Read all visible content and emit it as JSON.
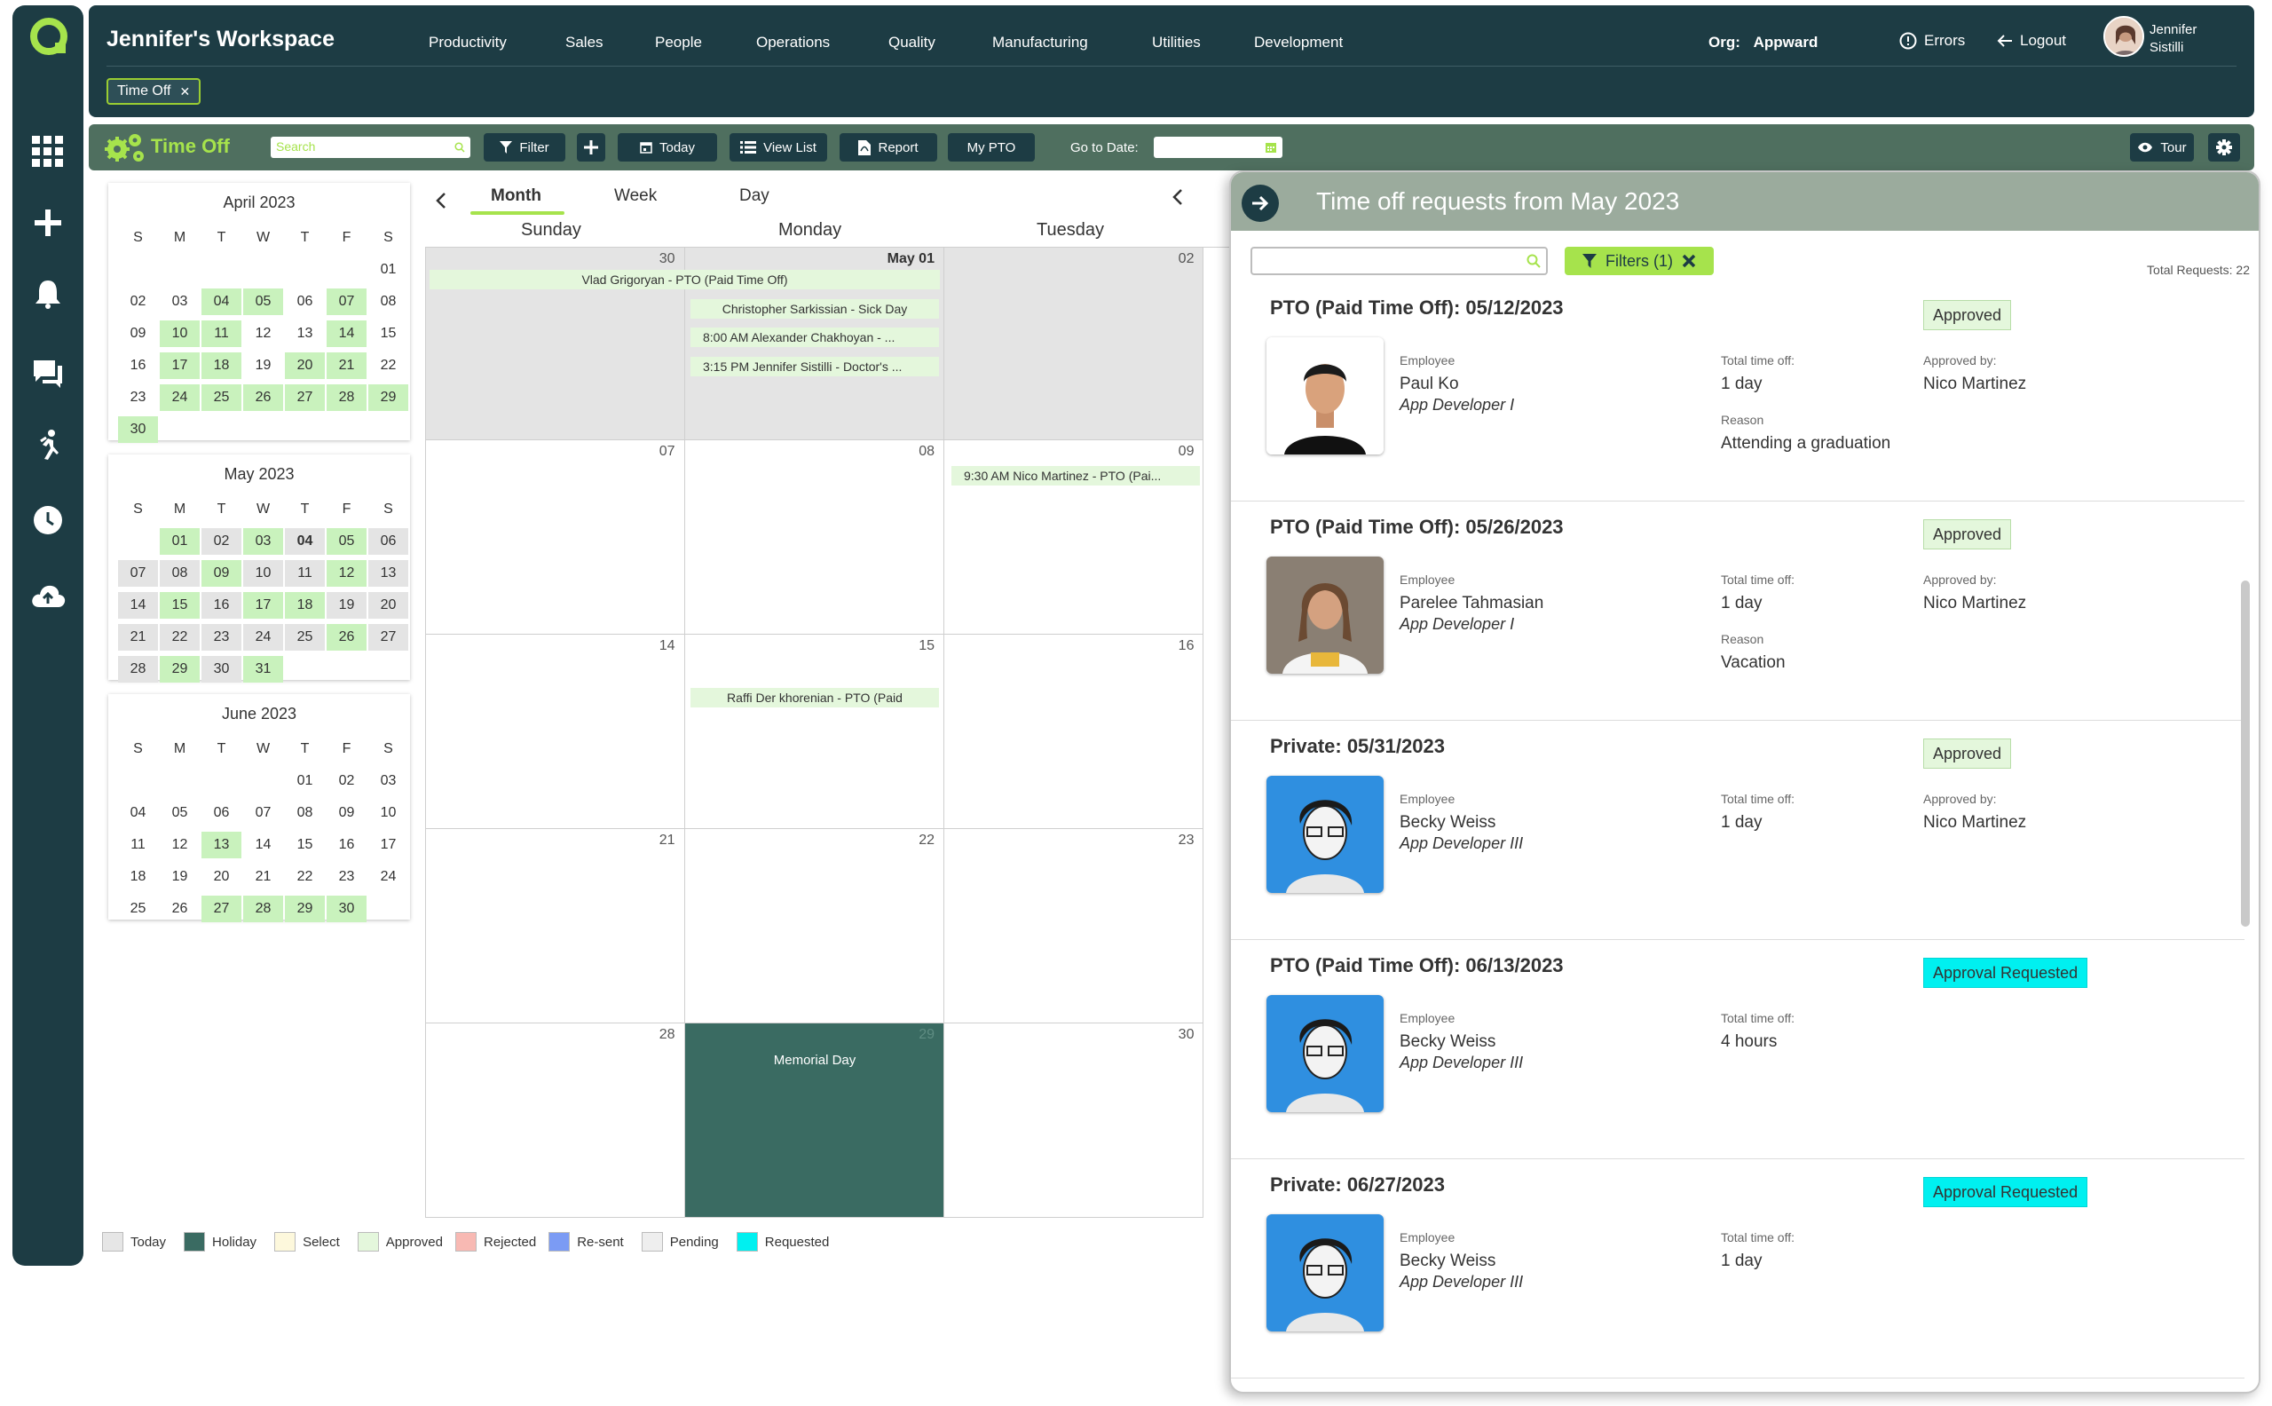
{
  "header": {
    "workspace_title": "Jennifer's Workspace",
    "nav": [
      "Productivity",
      "Sales",
      "People",
      "Operations",
      "Quality",
      "Manufacturing",
      "Utilities",
      "Development"
    ],
    "org_label": "Org:",
    "org_value": "Appward",
    "errors": "Errors",
    "logout": "Logout",
    "user_first": "Jennifer",
    "user_last": "Sistilli",
    "chip": "Time Off"
  },
  "toolbar": {
    "title": "Time Off",
    "search_placeholder": "Search",
    "filter": "Filter",
    "today": "Today",
    "view_list": "View List",
    "report": "Report",
    "my_pto": "My PTO",
    "goto_date": "Go to Date:",
    "tour": "Tour"
  },
  "minicals": [
    {
      "title": "April 2023",
      "dow": [
        "S",
        "M",
        "T",
        "W",
        "T",
        "F",
        "S"
      ],
      "cells": [
        {
          "d": "",
          "c": ""
        },
        {
          "d": "",
          "c": ""
        },
        {
          "d": "",
          "c": ""
        },
        {
          "d": "",
          "c": ""
        },
        {
          "d": "",
          "c": ""
        },
        {
          "d": "",
          "c": ""
        },
        {
          "d": "01",
          "c": ""
        },
        {
          "d": "02",
          "c": ""
        },
        {
          "d": "03",
          "c": ""
        },
        {
          "d": "04",
          "c": "ap"
        },
        {
          "d": "05",
          "c": "ap"
        },
        {
          "d": "06",
          "c": ""
        },
        {
          "d": "07",
          "c": "ap"
        },
        {
          "d": "08",
          "c": ""
        },
        {
          "d": "09",
          "c": ""
        },
        {
          "d": "10",
          "c": "ap"
        },
        {
          "d": "11",
          "c": "ap"
        },
        {
          "d": "12",
          "c": ""
        },
        {
          "d": "13",
          "c": ""
        },
        {
          "d": "14",
          "c": "ap"
        },
        {
          "d": "15",
          "c": ""
        },
        {
          "d": "16",
          "c": ""
        },
        {
          "d": "17",
          "c": "ap"
        },
        {
          "d": "18",
          "c": "ap"
        },
        {
          "d": "19",
          "c": ""
        },
        {
          "d": "20",
          "c": "ap"
        },
        {
          "d": "21",
          "c": "ap"
        },
        {
          "d": "22",
          "c": ""
        },
        {
          "d": "23",
          "c": ""
        },
        {
          "d": "24",
          "c": "ap"
        },
        {
          "d": "25",
          "c": "ap"
        },
        {
          "d": "26",
          "c": "ap"
        },
        {
          "d": "27",
          "c": "ap"
        },
        {
          "d": "28",
          "c": "ap"
        },
        {
          "d": "29",
          "c": "ap"
        },
        {
          "d": "30",
          "c": "ap"
        }
      ]
    },
    {
      "title": "May 2023",
      "dow": [
        "S",
        "M",
        "T",
        "W",
        "T",
        "F",
        "S"
      ],
      "cells": [
        {
          "d": "",
          "c": ""
        },
        {
          "d": "01",
          "c": "ap"
        },
        {
          "d": "02",
          "c": "gr"
        },
        {
          "d": "03",
          "c": "ap"
        },
        {
          "d": "04",
          "c": "gr td"
        },
        {
          "d": "05",
          "c": "ap"
        },
        {
          "d": "06",
          "c": "gr"
        },
        {
          "d": "07",
          "c": "gr"
        },
        {
          "d": "08",
          "c": "gr"
        },
        {
          "d": "09",
          "c": "ap"
        },
        {
          "d": "10",
          "c": "gr"
        },
        {
          "d": "11",
          "c": "gr"
        },
        {
          "d": "12",
          "c": "ap"
        },
        {
          "d": "13",
          "c": "gr"
        },
        {
          "d": "14",
          "c": "gr"
        },
        {
          "d": "15",
          "c": "ap"
        },
        {
          "d": "16",
          "c": "gr"
        },
        {
          "d": "17",
          "c": "ap"
        },
        {
          "d": "18",
          "c": "ap"
        },
        {
          "d": "19",
          "c": "gr"
        },
        {
          "d": "20",
          "c": "gr"
        },
        {
          "d": "21",
          "c": "gr"
        },
        {
          "d": "22",
          "c": "gr"
        },
        {
          "d": "23",
          "c": "gr"
        },
        {
          "d": "24",
          "c": "gr"
        },
        {
          "d": "25",
          "c": "gr"
        },
        {
          "d": "26",
          "c": "ap"
        },
        {
          "d": "27",
          "c": "gr"
        },
        {
          "d": "28",
          "c": "gr"
        },
        {
          "d": "29",
          "c": "ap"
        },
        {
          "d": "30",
          "c": "gr"
        },
        {
          "d": "31",
          "c": "ap"
        }
      ]
    },
    {
      "title": "June 2023",
      "dow": [
        "S",
        "M",
        "T",
        "W",
        "T",
        "F",
        "S"
      ],
      "cells": [
        {
          "d": "",
          "c": ""
        },
        {
          "d": "",
          "c": ""
        },
        {
          "d": "",
          "c": ""
        },
        {
          "d": "",
          "c": ""
        },
        {
          "d": "01",
          "c": ""
        },
        {
          "d": "02",
          "c": ""
        },
        {
          "d": "03",
          "c": ""
        },
        {
          "d": "04",
          "c": ""
        },
        {
          "d": "05",
          "c": ""
        },
        {
          "d": "06",
          "c": ""
        },
        {
          "d": "07",
          "c": ""
        },
        {
          "d": "08",
          "c": ""
        },
        {
          "d": "09",
          "c": ""
        },
        {
          "d": "10",
          "c": ""
        },
        {
          "d": "11",
          "c": ""
        },
        {
          "d": "12",
          "c": ""
        },
        {
          "d": "13",
          "c": "ap"
        },
        {
          "d": "14",
          "c": ""
        },
        {
          "d": "15",
          "c": ""
        },
        {
          "d": "16",
          "c": ""
        },
        {
          "d": "17",
          "c": ""
        },
        {
          "d": "18",
          "c": ""
        },
        {
          "d": "19",
          "c": ""
        },
        {
          "d": "20",
          "c": ""
        },
        {
          "d": "21",
          "c": ""
        },
        {
          "d": "22",
          "c": ""
        },
        {
          "d": "23",
          "c": ""
        },
        {
          "d": "24",
          "c": ""
        },
        {
          "d": "25",
          "c": ""
        },
        {
          "d": "26",
          "c": ""
        },
        {
          "d": "27",
          "c": "ap"
        },
        {
          "d": "28",
          "c": "ap"
        },
        {
          "d": "29",
          "c": "ap"
        },
        {
          "d": "30",
          "c": "ap"
        }
      ]
    }
  ],
  "calendar": {
    "tabs": [
      "Month",
      "Week",
      "Day"
    ],
    "day_headers": [
      "Sunday",
      "Monday",
      "Tuesday"
    ],
    "rows": [
      [
        "30",
        "May 01",
        "02"
      ],
      [
        "07",
        "08",
        "09"
      ],
      [
        "14",
        "15",
        "16"
      ],
      [
        "21",
        "22",
        "23"
      ],
      [
        "28",
        "29",
        "30"
      ]
    ],
    "events": {
      "vlad": "Vlad Grigoryan - PTO (Paid Time Off)",
      "christopher": "Christopher Sarkissian - Sick Day",
      "alexander": "8:00 AM Alexander Chakhoyan - ...",
      "jennifer": "3:15 PM Jennifer Sistilli - Doctor's ...",
      "nico": "9:30 AM Nico Martinez - PTO (Pai...",
      "raffi": "Raffi Der khorenian - PTO (Paid",
      "memorial": "Memorial Day"
    }
  },
  "legend": [
    "Today",
    "Holiday",
    "Select",
    "Approved",
    "Rejected",
    "Re-sent",
    "Pending",
    "Requested"
  ],
  "legend_colors": [
    "#e6e6e6",
    "#3a6b62",
    "#fdf8dc",
    "#e4f7dc",
    "#f8b9b3",
    "#7b9bf4",
    "#eeeeee",
    "#00f0f0"
  ],
  "panel": {
    "title": "Time off requests from May 2023",
    "filters": "Filters (1)",
    "total": "Total Requests: 22",
    "labels": {
      "employee": "Employee",
      "total_time": "Total time off:",
      "approved_by": "Approved by:",
      "reason": "Reason"
    },
    "requests": [
      {
        "title": "PTO (Paid Time Off): 05/12/2023",
        "status": "Approved",
        "name": "Paul Ko",
        "role": "App Developer I",
        "time": "1 day",
        "approver": "Nico Martinez",
        "reason": "Attending a graduation"
      },
      {
        "title": "PTO (Paid Time Off): 05/26/2023",
        "status": "Approved",
        "name": "Parelee Tahmasian",
        "role": "App Developer I",
        "time": "1 day",
        "approver": "Nico Martinez",
        "reason": "Vacation"
      },
      {
        "title": "Private: 05/31/2023",
        "status": "Approved",
        "name": "Becky Weiss",
        "role": "App Developer III",
        "time": "1 day",
        "approver": "Nico Martinez",
        "reason": ""
      },
      {
        "title": "PTO (Paid Time Off): 06/13/2023",
        "status": "Approval Requested",
        "name": "Becky Weiss",
        "role": "App Developer III",
        "time": "4 hours",
        "approver": "",
        "reason": ""
      },
      {
        "title": "Private: 06/27/2023",
        "status": "Approval Requested",
        "name": "Becky Weiss",
        "role": "App Developer III",
        "time": "1 day",
        "approver": "",
        "reason": ""
      }
    ]
  }
}
